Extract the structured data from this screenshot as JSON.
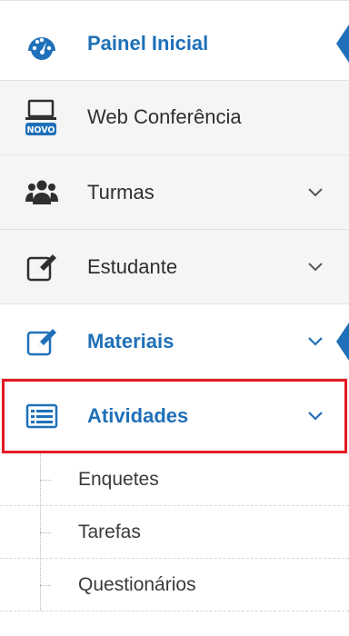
{
  "menu": {
    "items": [
      {
        "label": "Painel Inicial",
        "icon": "dashboard-gauge-icon",
        "active": true
      },
      {
        "label": "Web Conferência",
        "icon": "laptop-icon",
        "badge": "NOVO"
      },
      {
        "label": "Turmas",
        "icon": "users-group-icon",
        "has_chevron": true
      },
      {
        "label": "Estudante",
        "icon": "edit-icon",
        "has_chevron": true
      },
      {
        "label": "Materiais",
        "icon": "edit-icon",
        "active": true,
        "has_chevron": true
      },
      {
        "label": "Atividades",
        "icon": "list-icon",
        "active": true,
        "has_chevron": true,
        "expanded": true,
        "highlighted": true
      }
    ],
    "subitems": [
      {
        "label": "Enquetes"
      },
      {
        "label": "Tarefas"
      },
      {
        "label": "Questionários"
      }
    ]
  },
  "colors": {
    "accent": "#1f70b8",
    "text": "#2f2f2f",
    "highlight_border": "#e51a23",
    "separator": "#e3e3e3",
    "badge_bg": "#1f70b8"
  }
}
